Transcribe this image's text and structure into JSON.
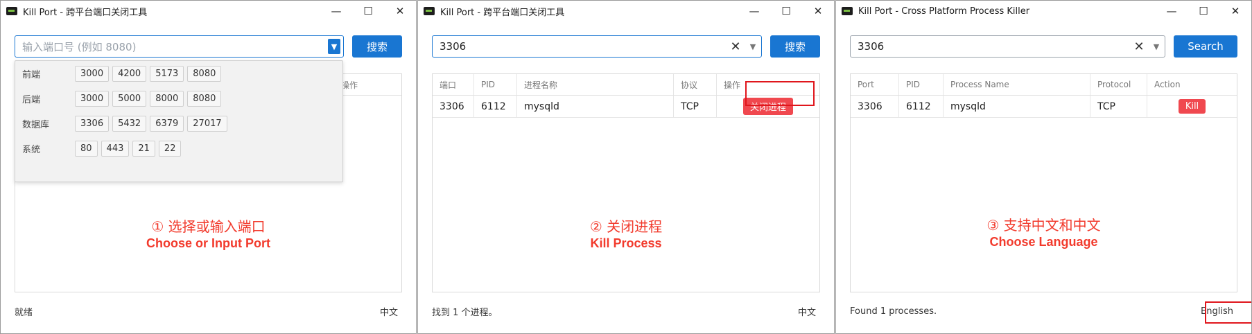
{
  "windows": [
    {
      "title": "Kill Port - 跨平台端口关闭工具",
      "search_placeholder": "输入端口号 (例如 8080)",
      "search_btn": "搜索",
      "table_header_partial": "操作",
      "dropdown": [
        {
          "label": "前端",
          "ports": [
            "3000",
            "4200",
            "5173",
            "8080"
          ]
        },
        {
          "label": "后端",
          "ports": [
            "3000",
            "5000",
            "8000",
            "8080"
          ]
        },
        {
          "label": "数据库",
          "ports": [
            "3306",
            "5432",
            "6379",
            "27017"
          ]
        },
        {
          "label": "系统",
          "ports": [
            "80",
            "443",
            "21",
            "22"
          ]
        }
      ],
      "status": "就绪",
      "lang": "中文",
      "caption_zh": "① 选择或输入端口",
      "caption_en": "Choose or Input Port"
    },
    {
      "title": "Kill Port - 跨平台端口关闭工具",
      "search_value": "3306",
      "search_btn": "搜索",
      "headers": [
        "端口",
        "PID",
        "进程名称",
        "协议",
        "操作"
      ],
      "row": {
        "port": "3306",
        "pid": "6112",
        "name": "mysqld",
        "protocol": "TCP",
        "action": "关闭进程"
      },
      "status": "找到 1 个进程。",
      "lang": "中文",
      "caption_zh": "② 关闭进程",
      "caption_en": "Kill Process"
    },
    {
      "title": "Kill Port - Cross Platform Process Killer",
      "search_value": "3306",
      "search_btn": "Search",
      "headers": [
        "Port",
        "PID",
        "Process Name",
        "Protocol",
        "Action"
      ],
      "row": {
        "port": "3306",
        "pid": "6112",
        "name": "mysqld",
        "protocol": "TCP",
        "action": "Kill"
      },
      "status": "Found 1 processes.",
      "lang": "English",
      "caption_zh": "③ 支持中文和中文",
      "caption_en": "Choose Language"
    }
  ],
  "window_controls": {
    "minimize": "—",
    "maximize": "☐",
    "close": "✕"
  },
  "colors": {
    "accent": "#1976d2",
    "kill": "#f0484f",
    "highlight": "#e0161c",
    "caption": "#f23a2c"
  }
}
